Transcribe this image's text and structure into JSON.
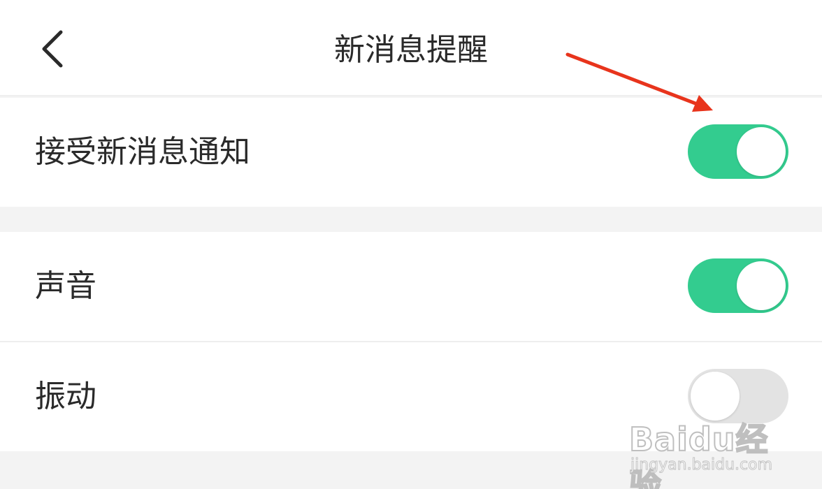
{
  "header": {
    "title": "新消息提醒",
    "back_icon": "chevron-left-icon"
  },
  "settings": [
    {
      "label": "接受新消息通知",
      "enabled": true
    },
    {
      "label": "声音",
      "enabled": true
    },
    {
      "label": "振动",
      "enabled": false
    }
  ],
  "colors": {
    "toggle_on": "#33cc8f",
    "toggle_off": "#e3e3e3",
    "annotation_arrow": "#e8341c"
  },
  "watermark": {
    "brand": "Baidu经验",
    "url": "jingyan.baidu.com"
  }
}
